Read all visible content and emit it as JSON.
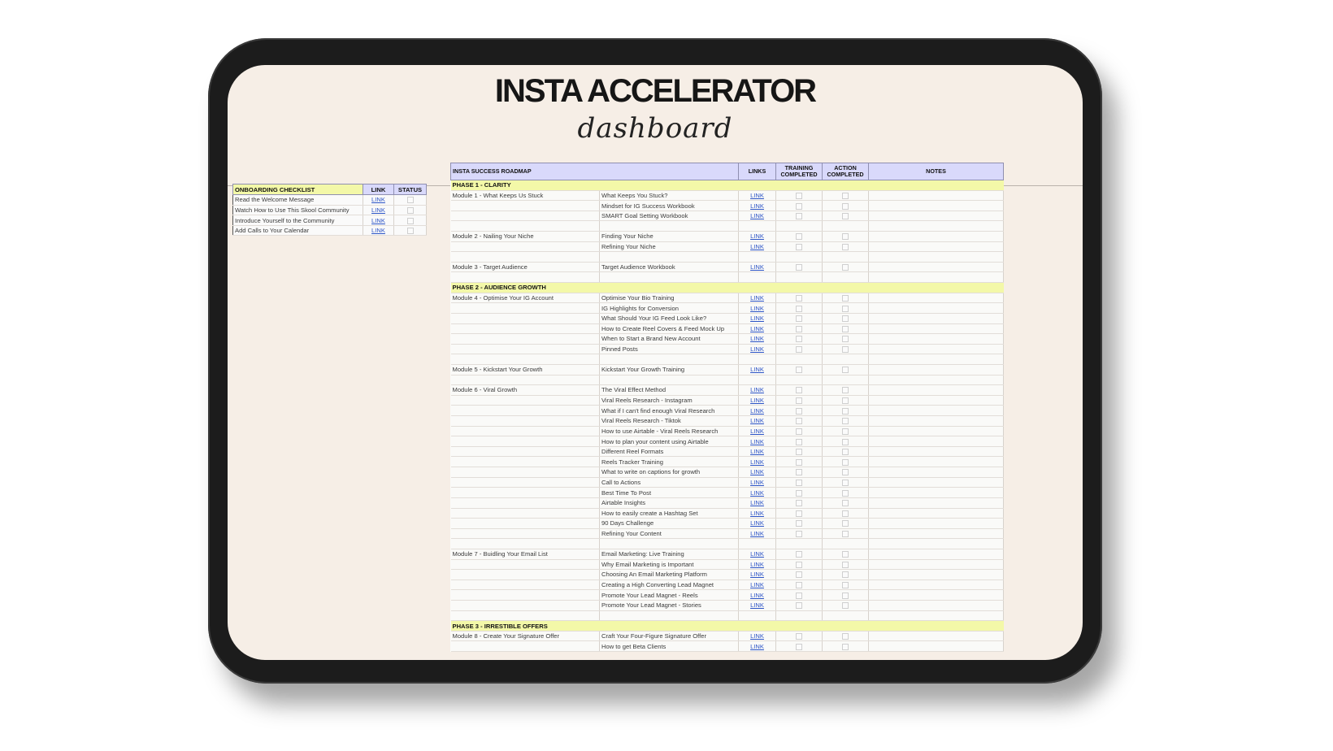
{
  "app": {
    "title": "INSTA ACCELERATOR",
    "subtitle": "dashboard"
  },
  "onboarding": {
    "headers": {
      "title": "ONBOARDING CHECKLIST",
      "link": "LINK",
      "status": "STATUS"
    },
    "items": [
      {
        "label": "Read the Welcome Message",
        "link": "LINK"
      },
      {
        "label": "Watch How to Use This Skool Community",
        "link": "LINK"
      },
      {
        "label": "Introduce Yourself to the Community",
        "link": "LINK"
      },
      {
        "label": "Add Calls to Your Calendar",
        "link": "LINK"
      }
    ]
  },
  "roadmap": {
    "headers": {
      "title": "INSTA SUCCESS ROADMAP",
      "links": "LINKS",
      "training": "TRAINING COMPLETED",
      "action": "ACTION COMPLETED",
      "notes": "NOTES"
    },
    "rows": [
      {
        "type": "phase",
        "label": "PHASE 1 - CLARITY"
      },
      {
        "type": "item",
        "module": "Module 1 - What Keeps Us Stuck",
        "lesson": "What Keeps You Stuck?",
        "link": "LINK"
      },
      {
        "type": "item",
        "module": "",
        "lesson": "Mindset for IG Success Workbook",
        "link": "LINK"
      },
      {
        "type": "item",
        "module": "",
        "lesson": "SMART Goal Setting Workbook",
        "link": "LINK"
      },
      {
        "type": "blank"
      },
      {
        "type": "item",
        "module": "Module 2 - Nailing Your Niche",
        "lesson": "Finding Your Niche",
        "link": "LINK"
      },
      {
        "type": "item",
        "module": "",
        "lesson": "Refining Your Niche",
        "link": "LINK"
      },
      {
        "type": "blank"
      },
      {
        "type": "item",
        "module": "Module 3 - Target Audience",
        "lesson": "Target Audience Workbook",
        "link": "LINK"
      },
      {
        "type": "blank"
      },
      {
        "type": "phase",
        "label": "PHASE 2 - AUDIENCE GROWTH"
      },
      {
        "type": "item",
        "module": "Module 4 - Optimise Your IG Account",
        "lesson": "Optimise Your Bio Training",
        "link": "LINK"
      },
      {
        "type": "item",
        "module": "",
        "lesson": "IG Highlights for Conversion",
        "link": "LINK"
      },
      {
        "type": "item",
        "module": "",
        "lesson": "What Should Your IG Feed Look Like?",
        "link": "LINK"
      },
      {
        "type": "item",
        "module": "",
        "lesson": "How to Create Reel Covers & Feed Mock Up",
        "link": "LINK"
      },
      {
        "type": "item",
        "module": "",
        "lesson": "When to Start a Brand New Account",
        "link": "LINK"
      },
      {
        "type": "item",
        "module": "",
        "lesson": "Pinned Posts",
        "link": "LINK"
      },
      {
        "type": "blank"
      },
      {
        "type": "item",
        "module": "Module 5 - Kickstart Your Growth",
        "lesson": "Kickstart Your Growth Training",
        "link": "LINK"
      },
      {
        "type": "blank"
      },
      {
        "type": "item",
        "module": "Module 6 - Viral Growth",
        "lesson": "The Viral Effect Method",
        "link": "LINK"
      },
      {
        "type": "item",
        "module": "",
        "lesson": "Viral Reels Research - Instagram",
        "link": "LINK"
      },
      {
        "type": "item",
        "module": "",
        "lesson": "What if I can't find enough Viral Research",
        "link": "LINK"
      },
      {
        "type": "item",
        "module": "",
        "lesson": "Viral Reels Research - Tiktok",
        "link": "LINK"
      },
      {
        "type": "item",
        "module": "",
        "lesson": "How to use Airtable - Viral Reels Research",
        "link": "LINK"
      },
      {
        "type": "item",
        "module": "",
        "lesson": "How to plan your content using Airtable",
        "link": "LINK"
      },
      {
        "type": "item",
        "module": "",
        "lesson": "Different Reel Formats",
        "link": "LINK"
      },
      {
        "type": "item",
        "module": "",
        "lesson": "Reels Tracker Training",
        "link": "LINK"
      },
      {
        "type": "item",
        "module": "",
        "lesson": "What to write on captions for growth",
        "link": "LINK"
      },
      {
        "type": "item",
        "module": "",
        "lesson": "Call to Actions",
        "link": "LINK"
      },
      {
        "type": "item",
        "module": "",
        "lesson": "Best Time To Post",
        "link": "LINK"
      },
      {
        "type": "item",
        "module": "",
        "lesson": "Airtable Insights",
        "link": "LINK"
      },
      {
        "type": "item",
        "module": "",
        "lesson": "How to easily create a Hashtag Set",
        "link": "LINK"
      },
      {
        "type": "item",
        "module": "",
        "lesson": "90 Days Challenge",
        "link": "LINK"
      },
      {
        "type": "item",
        "module": "",
        "lesson": "Refining Your Content",
        "link": "LINK"
      },
      {
        "type": "blank"
      },
      {
        "type": "item",
        "module": "Module 7 - Buidling Your Email List",
        "lesson": "Email Marketing: Live Training",
        "link": "LINK"
      },
      {
        "type": "item",
        "module": "",
        "lesson": "Why Email Marketing is Important",
        "link": "LINK"
      },
      {
        "type": "item",
        "module": "",
        "lesson": "Choosing An Email Marketing Platform",
        "link": "LINK"
      },
      {
        "type": "item",
        "module": "",
        "lesson": "Creating a High Converting Lead Magnet",
        "link": "LINK"
      },
      {
        "type": "item",
        "module": "",
        "lesson": "Promote Your Lead Magnet - Reels",
        "link": "LINK"
      },
      {
        "type": "item",
        "module": "",
        "lesson": "Promote Your Lead Magnet - Stories",
        "link": "LINK"
      },
      {
        "type": "blank"
      },
      {
        "type": "phase",
        "label": "PHASE 3 - IRRESTIBLE OFFERS"
      },
      {
        "type": "item",
        "module": "Module 8 - Create Your Signature Offer",
        "lesson": "Craft Your Four-Figure Signature Offer",
        "link": "LINK"
      },
      {
        "type": "item",
        "module": "",
        "lesson": "How to get Beta Clients",
        "link": "LINK"
      }
    ]
  }
}
